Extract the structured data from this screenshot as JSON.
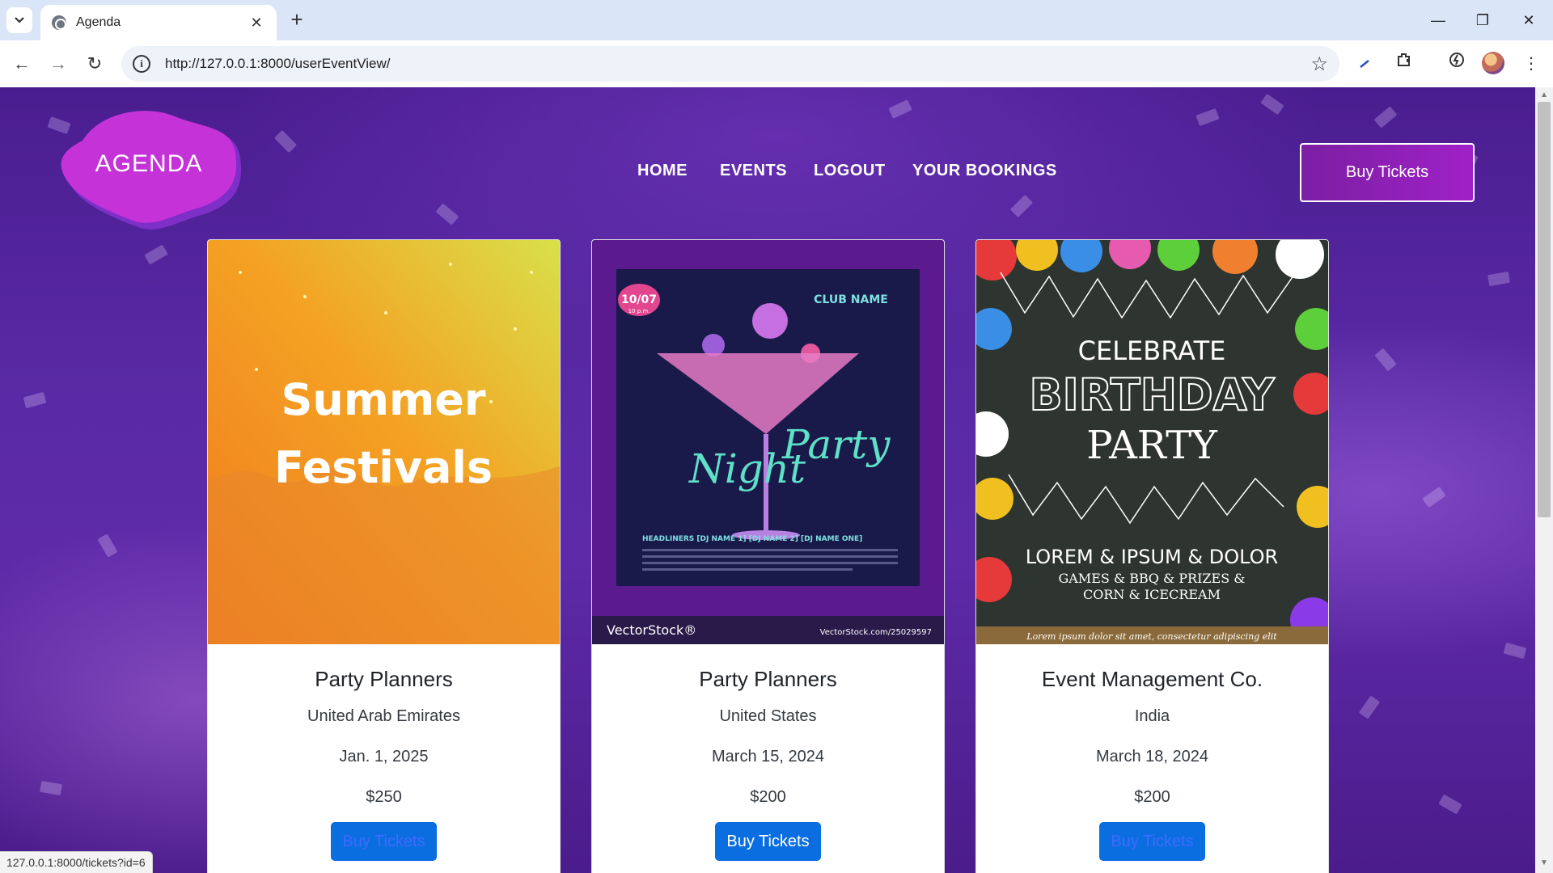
{
  "browser": {
    "tab_title": "Agenda",
    "url": "http://127.0.0.1:8000/userEventView/",
    "status_url": "127.0.0.1:8000/tickets?id=6"
  },
  "site": {
    "logo_text": "AGENDA",
    "nav": [
      "HOME",
      "EVENTS",
      "LOGOUT",
      "YOUR BOOKINGS"
    ],
    "cta_label": "Buy Tickets"
  },
  "posters": {
    "summer": {
      "line1": "Summer",
      "line2": "Festivals"
    },
    "night": {
      "date": "10/07",
      "time": "10 p.m.",
      "club": "CLUB NAME",
      "title_word1": "Night",
      "title_word2": "Party",
      "headliners": "HEADLINERS   [DJ NAME 1]  [DJ NAME 2]  [DJ NAME ONE]",
      "watermark_left": "VectorStock®",
      "watermark_right": "VectorStock.com/25029597"
    },
    "birthday": {
      "line1": "CELEBRATE",
      "line2": "BIRTHDAY",
      "line3": "PARTY",
      "line4": "LOREM & IPSUM & DOLOR",
      "line5": "GAMES & BBQ & PRIZES &",
      "line6": "CORN & ICECREAM",
      "footer": "Lorem ipsum dolor sit amet, consectetur adipiscing elit"
    }
  },
  "events": [
    {
      "organizer": "Party Planners",
      "country": "United Arab Emirates",
      "date": "Jan. 1, 2025",
      "price": "$250",
      "button": "Buy Tickets",
      "button_text_color": "#4169ff"
    },
    {
      "organizer": "Party Planners",
      "country": "United States",
      "date": "March 15, 2024",
      "price": "$200",
      "button": "Buy Tickets",
      "button_text_color": "#ffffff"
    },
    {
      "organizer": "Event Management Co.",
      "country": "India",
      "date": "March 18, 2024",
      "price": "$200",
      "button": "Buy Tickets",
      "button_text_color": "#4169ff"
    }
  ],
  "icons": [
    "tab-search-icon",
    "favicon-icon",
    "close-icon",
    "plus-icon",
    "minimize-icon",
    "restore-icon",
    "window-close-icon",
    "back-icon",
    "forward-icon",
    "reload-icon",
    "info-icon",
    "star-icon",
    "pen-icon",
    "extensions-icon",
    "performance-icon",
    "menu-icon"
  ],
  "colors": {
    "page_bg": "#5a2aa6",
    "cta": "#a020c8",
    "card_button": "#0b6ee0"
  }
}
